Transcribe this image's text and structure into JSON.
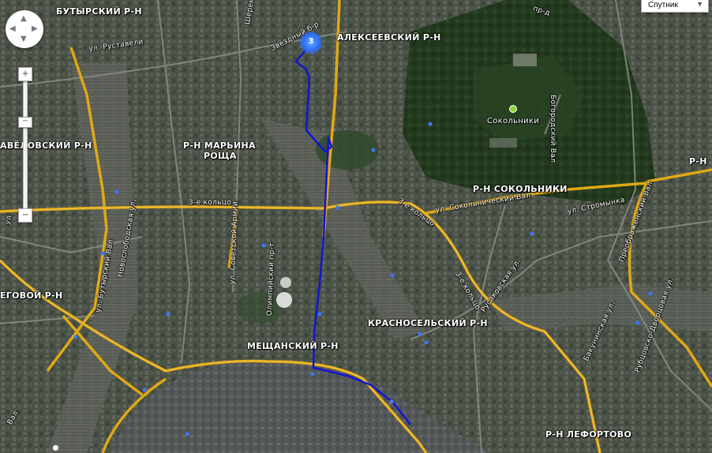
{
  "map_type": {
    "selected": "Спутник",
    "arrow": "▼"
  },
  "controls": {
    "zoom_in": "+",
    "zoom_out": "−",
    "pan_up": "▲",
    "pan_down": "▼",
    "pan_left": "◀",
    "pan_right": "▶",
    "handle": "−"
  },
  "cluster": {
    "count": "3"
  },
  "districts": {
    "butyrsky": "БУТЫРСКИЙ Р-Н",
    "alekseevsky": "АЛЕКСЕЕВСКИЙ Р-Н",
    "savelovsky": "АВЁЛОВСКИЙ Р-Н",
    "maryina_line1": "Р-Н МАРЬИНА",
    "maryina_line2": "РОЩА",
    "sokolniki_district": "Р-Н СОКОЛЬНИКИ",
    "begovoy": "ЕГОВОЙ Р-Н",
    "krasnoselsky": "КРАСНОСЕЛЬСКИЙ Р-Н",
    "meshchansky": "МЕЩАНСКИЙ Р-Н",
    "lefortovo": "Р-Н ЛЕФОРТОВО",
    "right_edge": "Р-Н"
  },
  "streets": {
    "rustaveli": "ул. Руставели",
    "zvezdny": "Звездный б-р",
    "ring_w": "3-е кольцо",
    "ring_e": "3-е кольцо",
    "ring_se": "3-е кольцо",
    "sokolnichesky_val": "ул. Сокольнический Вал",
    "stromynka": "ул. Стромынка",
    "rusakovskaya": "Русаковская ул.",
    "bakuninskaya": "Бакунинская ул.",
    "preobrazhensky_val": "Преображенский Вал",
    "bogorodsky_val": "Богородский Вал",
    "rubtsovsko": "Рубцовско-Дворцовая ул.",
    "novoslobodskaya": "Новослободская ул.",
    "butyrsky_val": "ул. Бутырский Вал",
    "sovetskoy_armii": "ул. Советской Армии",
    "olimpiysky": "Олимпийский пр-т",
    "sheremetyevskaya": "Шереметьевская ул.",
    "top_pr": "пр-д",
    "left_val": "Вал",
    "left_ul": "ул."
  },
  "poi": {
    "sokolniki": "Сокольники"
  },
  "colors": {
    "route": "#1414d2",
    "major_road": "#e0a816",
    "ring_road": "#d9a31c",
    "cluster": "#2f74ff",
    "forest": "#243d1f"
  }
}
